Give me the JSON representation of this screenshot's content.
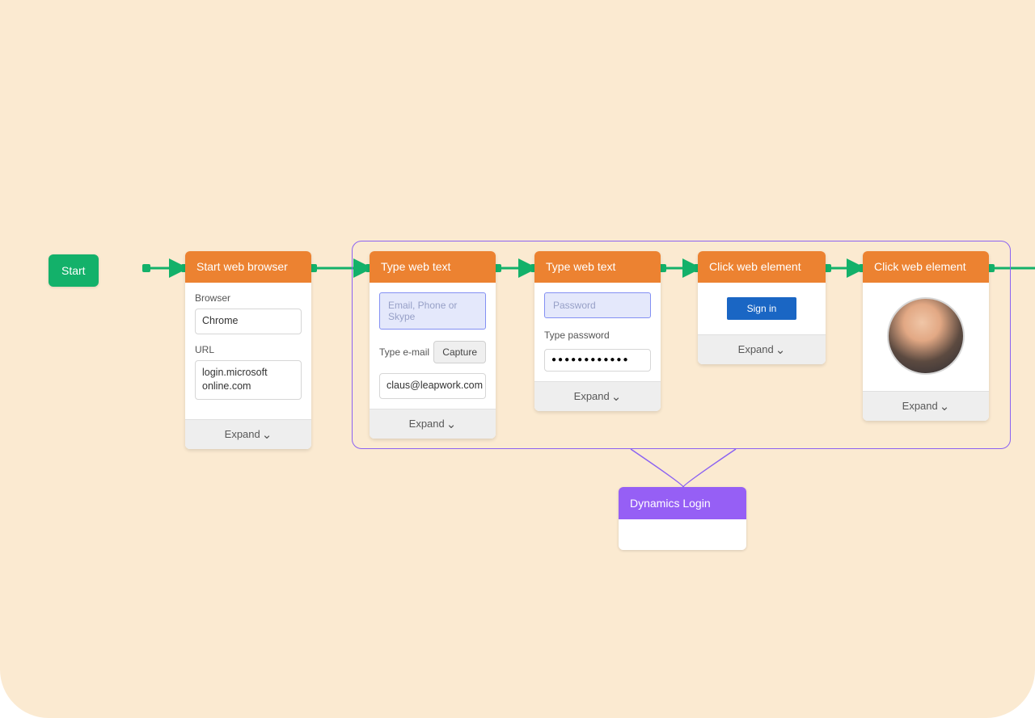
{
  "colors": {
    "cream": "#fbead1",
    "orange": "#ec8231",
    "startGreen": "#13b16a",
    "purple": "#965ff5",
    "groupBorder": "#8b62f2",
    "signinBlue": "#1a66c4"
  },
  "start": {
    "label": "Start"
  },
  "expand_label": "Expand",
  "cards": {
    "browser": {
      "title": "Start web browser",
      "browser_label": "Browser",
      "browser_value": "Chrome",
      "url_label": "URL",
      "url_value": "login.microsoft\nonline.com"
    },
    "type_email": {
      "title": "Type web text",
      "preview_placeholder": "Email, Phone or Skype",
      "label": "Type e-mail",
      "capture": "Capture",
      "value": "claus@leapwork.com"
    },
    "type_password": {
      "title": "Type web text",
      "preview_placeholder": "Password",
      "label": "Type password",
      "value_mask": "●●●●●●●●●●●●"
    },
    "click_signin": {
      "title": "Click web element",
      "signin": "Sign in"
    },
    "click_avatar": {
      "title": "Click web element"
    }
  },
  "group": {
    "title": "Dynamics Login"
  }
}
